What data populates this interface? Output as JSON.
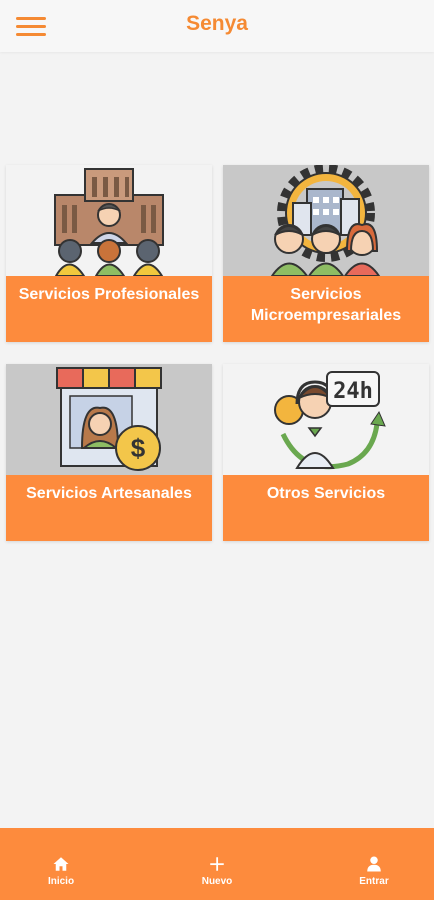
{
  "header": {
    "title": "Senya",
    "menu_icon": "hamburger-menu-icon"
  },
  "categories": [
    {
      "label": "Servicios Profesionales",
      "icon": "professionals-group-icon",
      "image_bg": "#f3f3f3"
    },
    {
      "label": "Servicios Microempresariales",
      "icon": "business-team-icon",
      "image_bg": "#c8c8c8"
    },
    {
      "label": "Servicios Artesanales",
      "icon": "artisan-shop-icon",
      "image_bg": "#c8c8c8"
    },
    {
      "label": "Otros Servicios",
      "icon": "support-24h-icon",
      "image_bg": "#f3f3f3"
    }
  ],
  "bottom_nav": [
    {
      "label": "Inicio",
      "icon": "home-icon"
    },
    {
      "label": "Nuevo",
      "icon": "plus-icon"
    },
    {
      "label": "Entrar",
      "icon": "user-icon"
    }
  ],
  "colors": {
    "accent": "#fd8b3d",
    "title": "#f58a33",
    "background": "#f3f3f3",
    "image_gray": "#c8c8c8"
  }
}
